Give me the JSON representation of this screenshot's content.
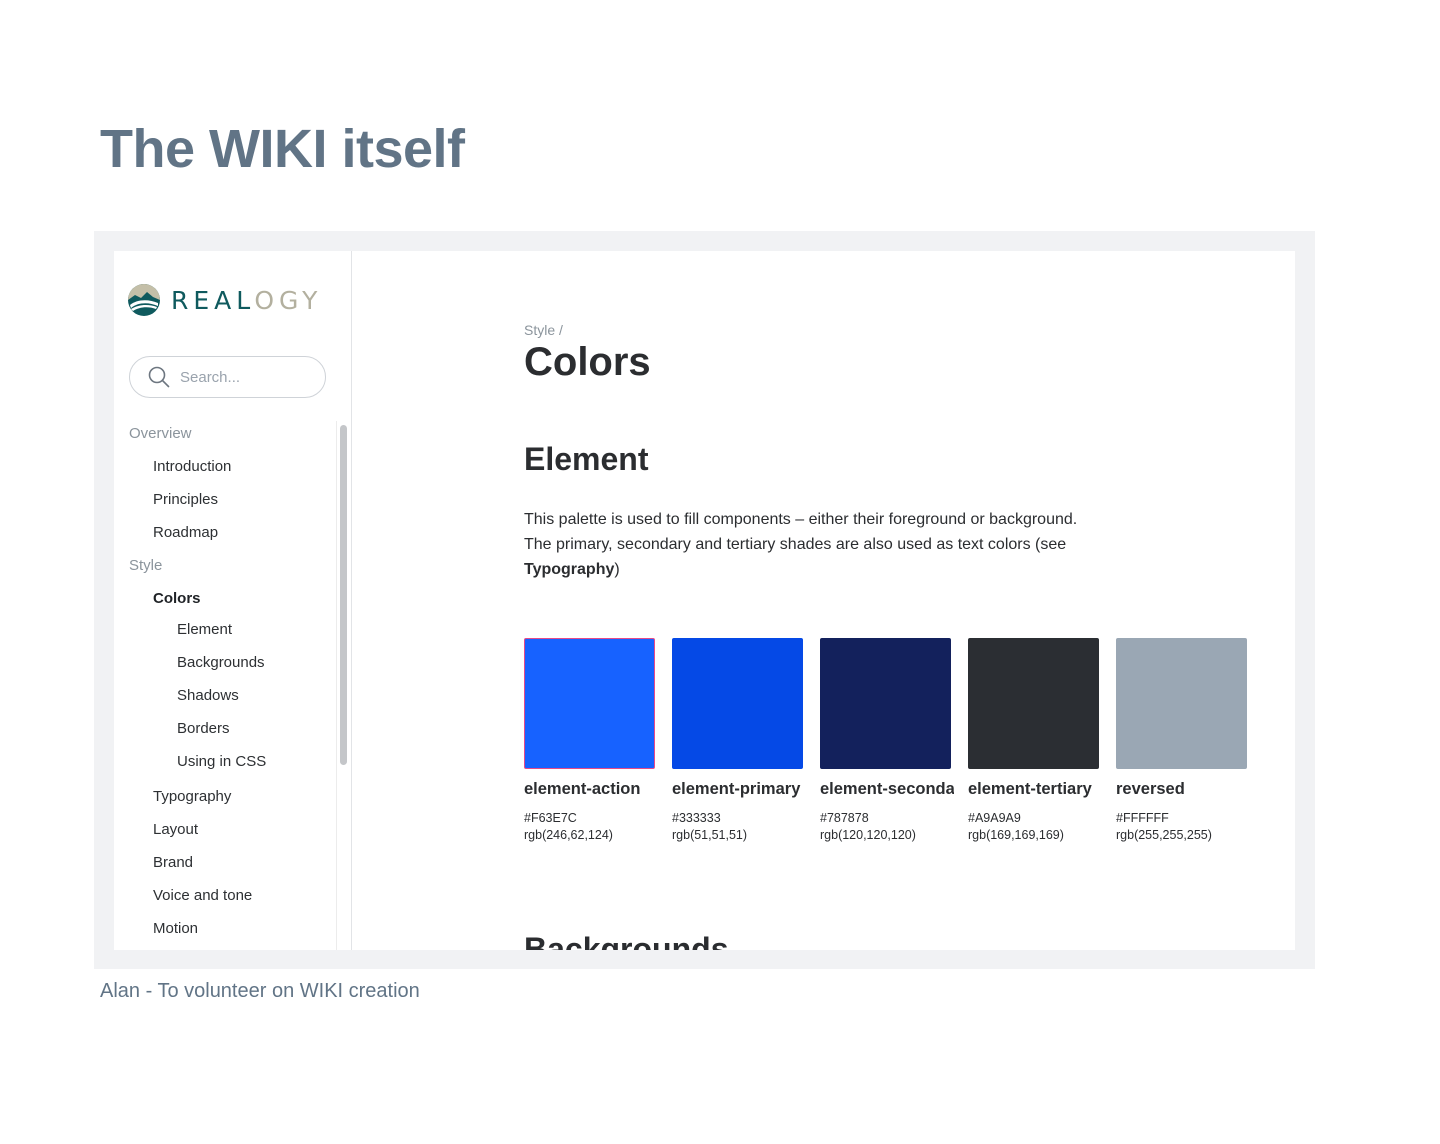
{
  "slide": {
    "title": "The WIKI itself",
    "caption": "Alan - To volunteer on WIKI creation"
  },
  "brand": {
    "name_main": "REAL",
    "name_accent": "OGY",
    "logo_icon": "realogy-mountain-icon"
  },
  "search": {
    "placeholder": "Search..."
  },
  "nav": {
    "overview": "Overview",
    "introduction": "Introduction",
    "principles": "Principles",
    "roadmap": "Roadmap",
    "style": "Style",
    "colors": "Colors",
    "element": "Element",
    "backgrounds": "Backgrounds",
    "shadows": "Shadows",
    "borders": "Borders",
    "using_in_css": "Using in CSS",
    "typography": "Typography",
    "layout": "Layout",
    "brand": "Brand",
    "voice_and_tone": "Voice and tone",
    "motion": "Motion"
  },
  "main": {
    "breadcrumb": "Style /",
    "title": "Colors",
    "section_title": "Element",
    "description_start": "This palette is used to fill components – either their foreground or background. The primary, secondary and tertiary shades are also used as text colors (see ",
    "description_link": "Typography",
    "description_end": ")",
    "next_section": "Backgrounds"
  },
  "swatches": [
    {
      "name": "element-action",
      "hex": "#F63E7C",
      "rgb": "rgb(246,62,124)",
      "display_color": "#1762ff",
      "border_color": "#e64a8a"
    },
    {
      "name": "element-primary",
      "hex": "#333333",
      "rgb": "rgb(51,51,51)",
      "display_color": "#0549e6",
      "border_color": "#0549e6"
    },
    {
      "name": "element-secondary",
      "hex": "#787878",
      "rgb": "rgb(120,120,120)",
      "display_color": "#13215c",
      "border_color": "#13215c"
    },
    {
      "name": "element-tertiary",
      "hex": "#A9A9A9",
      "rgb": "rgb(169,169,169)",
      "display_color": "#2b2e33",
      "border_color": "#2b2e33"
    },
    {
      "name": "reversed",
      "hex": "#FFFFFF",
      "rgb": "rgb(255,255,255)",
      "display_color": "#9aa7b4",
      "border_color": "#9aa7b4"
    }
  ]
}
